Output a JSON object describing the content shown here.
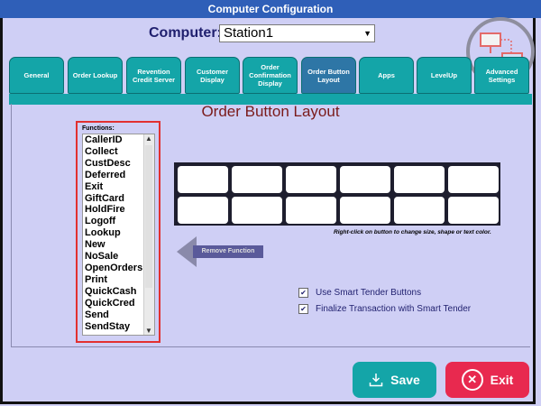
{
  "window": {
    "title": "Computer Configuration"
  },
  "computer": {
    "label": "Computer:",
    "value": "Station1"
  },
  "tabs": [
    {
      "label": "General"
    },
    {
      "label": "Order Lookup"
    },
    {
      "label": "Revention Credit Server"
    },
    {
      "label": "Customer Display"
    },
    {
      "label": "Order Confirmation Display"
    },
    {
      "label": "Order Button Layout"
    },
    {
      "label": "Apps"
    },
    {
      "label": "LevelUp"
    },
    {
      "label": "Advanced Settings"
    }
  ],
  "active_tab": "Order Button Layout",
  "section": {
    "title": "Order Button Layout"
  },
  "functions": {
    "label": "Functions:",
    "items": [
      "CallerID",
      "Collect",
      "CustDesc",
      "Deferred",
      "Exit",
      "GiftCard",
      "HoldFire",
      "Logoff",
      "Lookup",
      "New",
      "NoSale",
      "OpenOrders",
      "Print",
      "QuickCash",
      "QuickCred",
      "Send",
      "SendStay"
    ]
  },
  "grid": {
    "hint": "Right-click on button to change size, shape or text color.",
    "rows": 2,
    "cols": 6
  },
  "remove_button": {
    "label": "Remove Function"
  },
  "options": [
    {
      "label": "Use Smart Tender Buttons",
      "checked": true
    },
    {
      "label": "Finalize Transaction with Smart Tender",
      "checked": true
    }
  ],
  "buttons": {
    "save": "Save",
    "exit": "Exit"
  },
  "icons": {
    "network": "network-icon",
    "save": "save-icon",
    "exit": "close-icon"
  },
  "colors": {
    "titlebar": "#2f5fb8",
    "tab": "#14a5a8",
    "tab_active": "#2e76a6",
    "save": "#14a5a8",
    "exit": "#e8294f",
    "background": "#cfcff5",
    "highlight": "#e23030"
  }
}
